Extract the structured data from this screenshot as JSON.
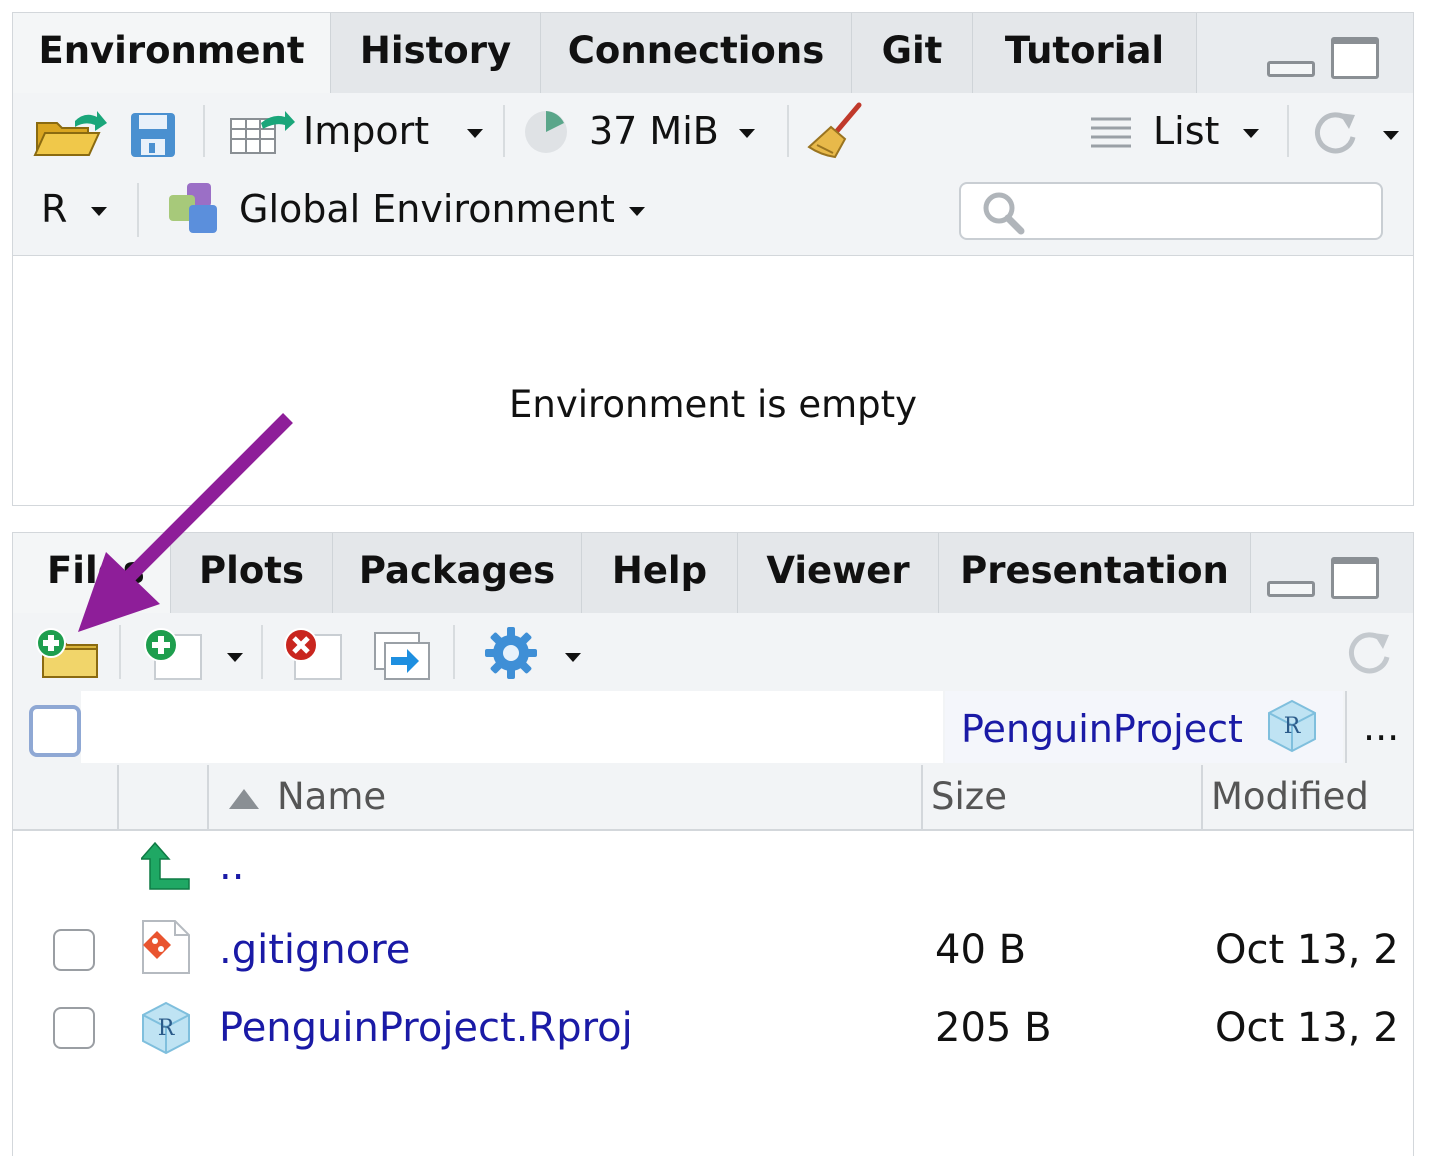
{
  "env_pane": {
    "tabs": [
      "Environment",
      "History",
      "Connections",
      "Git",
      "Tutorial"
    ],
    "toolbar": {
      "import_label": "Import",
      "memory_label": "37 MiB",
      "view_label": "List"
    },
    "scope": {
      "language_label": "R",
      "environment_label": "Global Environment",
      "search_placeholder": ""
    },
    "empty_message": "Environment is empty"
  },
  "files_pane": {
    "tabs": [
      "Files",
      "Plots",
      "Packages",
      "Help",
      "Viewer",
      "Presentation"
    ],
    "breadcrumb": {
      "project_label": "PenguinProject",
      "more_label": "..."
    },
    "columns": {
      "name": "Name",
      "size": "Size",
      "modified": "Modified"
    },
    "parent_link": "..",
    "rows": [
      {
        "name": ".gitignore",
        "size": "40 B",
        "modified": "Oct 13, 2",
        "icon": "git-file-icon"
      },
      {
        "name": "PenguinProject.Rproj",
        "size": "205 B",
        "modified": "Oct 13, 2",
        "icon": "rproj-file-icon"
      }
    ]
  },
  "annotation": {
    "arrow_color": "#8e1e99",
    "target": "new-folder-button"
  },
  "colors": {
    "link": "#1a1aa6",
    "tab_bg": "#e4e7ea",
    "toolbar_bg": "#f2f4f6"
  }
}
